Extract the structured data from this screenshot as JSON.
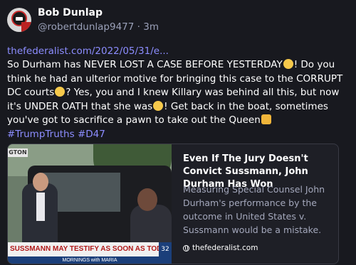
{
  "author": {
    "name": "Bob Dunlap",
    "handle": "@robertdunlap9477",
    "separator": "·",
    "time": "3m",
    "avatar_badge_text": "SON OF"
  },
  "post": {
    "link": "thefederalist.com/2022/05/31/e...",
    "text_1": "So Durham has NEVER LOST A CASE BEFORE YESTERDAY",
    "text_2": "! Do you think he had an ulterior motive for bringing this case to the CORRUPT DC courts",
    "text_3": "? Yes, you and I knew Killary was behind all this, but now it's UNDER OATH that she was",
    "text_4": "! Get back in the boat, sometimes you've got to sacrifice a pawn to take out the Queen",
    "hashtags": [
      "#TrumpTruths",
      "#D47"
    ],
    "emojis": [
      "flushed-face",
      "thinking-face",
      "astonished-face",
      "oncoming-fist"
    ]
  },
  "card": {
    "title": "Even If The Jury Doesn't Convict Sussmann, John Durham Has Won",
    "description": "Measuring Special Counsel John Durham's performance by the outcome in United States v. Sussmann would be a mistake.",
    "source": "thefederalist.com",
    "image": {
      "sign": "GTON",
      "chyron": "SUSSMANN MAY TESTIFY AS SOON AS TODAY",
      "ticker": "MORNINGS with MARIA",
      "clock": "32"
    }
  },
  "colors": {
    "background": "#18191f",
    "link": "#8c8dff",
    "muted": "#9aa0b8"
  }
}
